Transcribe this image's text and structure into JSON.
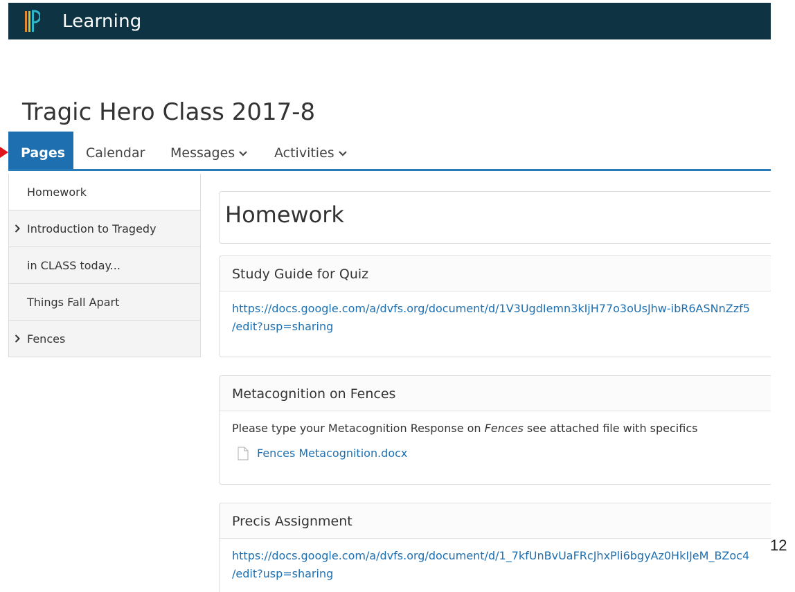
{
  "header": {
    "brand": "Learning"
  },
  "class_title": "Tragic Hero Class 2017-8",
  "tabs": [
    {
      "label": "Pages",
      "active": true,
      "dropdown": false
    },
    {
      "label": "Calendar",
      "active": false,
      "dropdown": false
    },
    {
      "label": "Messages",
      "active": false,
      "dropdown": true
    },
    {
      "label": "Activities",
      "active": false,
      "dropdown": true
    }
  ],
  "sidebar": {
    "items": [
      {
        "label": "Homework",
        "expandable": false,
        "current": true
      },
      {
        "label": "Introduction to Tragedy",
        "expandable": true,
        "current": false
      },
      {
        "label": "in CLASS today...",
        "expandable": false,
        "current": false
      },
      {
        "label": "Things Fall Apart",
        "expandable": false,
        "current": false
      },
      {
        "label": "Fences",
        "expandable": true,
        "current": false
      }
    ]
  },
  "page": {
    "title": "Homework",
    "sections": [
      {
        "title": "Study Guide for Quiz",
        "link_line1": "https://docs.google.com/a/dvfs.org/document/d/1V3UgdIemn3kIjH77o3oUsJhw-ibR6ASNnZzf5",
        "link_line2": "/edit?usp=sharing"
      },
      {
        "title": "Metacognition on Fences",
        "text_before": "Please type your Metacognition Response on ",
        "text_em": "Fences",
        "text_after": " see attached file with specifics",
        "file": "Fences Metacognition.docx"
      },
      {
        "title": "Precis Assignment",
        "link_line1": "https://docs.google.com/a/dvfs.org/document/d/1_7kfUnBvUaFRcJhxPli6bgyAz0HkIJeM_BZoc4",
        "link_line2": "/edit?usp=sharing"
      }
    ]
  },
  "slide_number": "12",
  "colors": {
    "topbar": "#0e3443",
    "accent": "#1d6fb0",
    "link": "#1d6fb0",
    "pointer_arrow": "#e0161e"
  }
}
